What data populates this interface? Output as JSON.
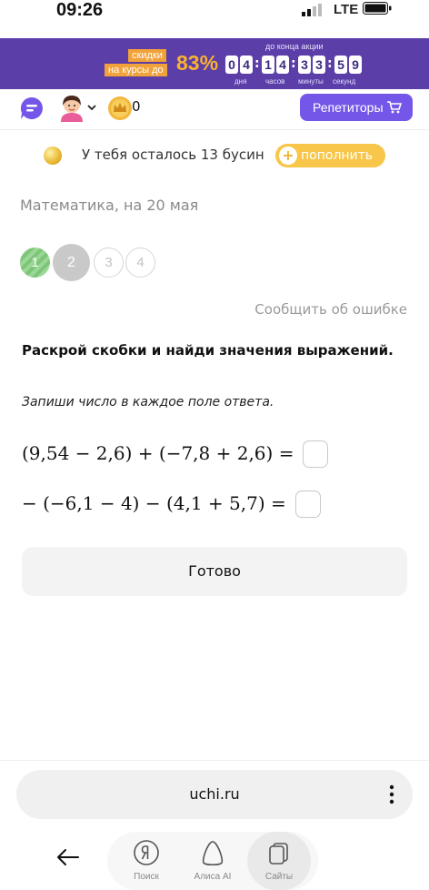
{
  "status_bar": {
    "time": "09:26",
    "network": "LTE"
  },
  "promo": {
    "tag_line1": "скидки",
    "tag_line2": "на курсы до",
    "percent": "83%",
    "until_label": "до конца акции",
    "timer_digits": [
      "0",
      "4",
      "1",
      "4",
      "3",
      "3",
      "5",
      "9"
    ],
    "timer_units": [
      "дня",
      "часов",
      "минуты",
      "секунд"
    ]
  },
  "toolbar": {
    "coins": "0",
    "tutors_label": "Репетиторы"
  },
  "beads": {
    "text": "У тебя осталось 13 бусин",
    "refill_label": "пополнить"
  },
  "lesson": {
    "subject": "Математика, на 20 мая",
    "steps": [
      "1",
      "2",
      "3",
      "4"
    ],
    "current_step": 2,
    "report_label": "Сообщить об ошибке",
    "task_title": "Раскрой скобки и найди значения выражений.",
    "task_hint": "Запиши число в каждое поле ответа.",
    "expressions": [
      "(9,54 − 2,6) + (−7,8 + 2,6) =",
      "− (−6,1 − 4) − (4,1 + 5,7) ="
    ],
    "answers": [
      "",
      ""
    ],
    "done_label": "Готово"
  },
  "browser": {
    "url": "uchi.ru",
    "nav": [
      {
        "label": "Поиск",
        "icon": "yandex-icon"
      },
      {
        "label": "Алиса AI",
        "icon": "alice-icon"
      },
      {
        "label": "Сайты",
        "icon": "tabs-icon",
        "active": true
      }
    ]
  }
}
